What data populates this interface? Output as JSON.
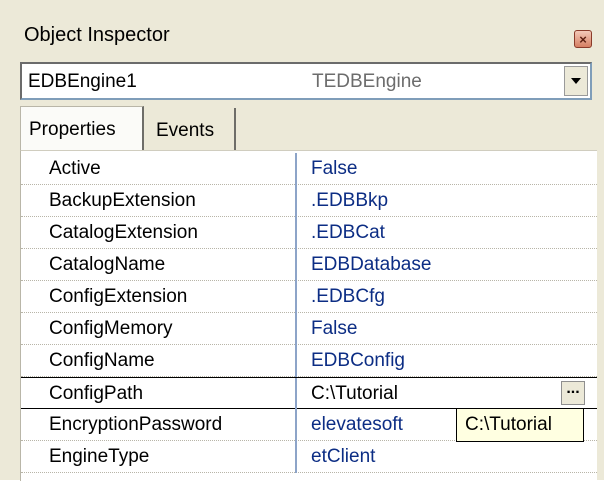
{
  "window": {
    "title": "Object Inspector",
    "close_label": "×"
  },
  "combo": {
    "object_name": "EDBEngine1",
    "object_type": "TEDBEngine"
  },
  "tabs": [
    {
      "label": "Properties"
    },
    {
      "label": "Events"
    }
  ],
  "properties": [
    {
      "name": "Active",
      "value": "False"
    },
    {
      "name": "BackupExtension",
      "value": ".EDBBkp"
    },
    {
      "name": "CatalogExtension",
      "value": ".EDBCat"
    },
    {
      "name": "CatalogName",
      "value": "EDBDatabase"
    },
    {
      "name": "ConfigExtension",
      "value": ".EDBCfg"
    },
    {
      "name": "ConfigMemory",
      "value": "False"
    },
    {
      "name": "ConfigName",
      "value": "EDBConfig"
    },
    {
      "name": "ConfigPath",
      "value": "C:\\Tutorial"
    },
    {
      "name": "EncryptionPassword",
      "value": "elevatesoft"
    },
    {
      "name": "EngineType",
      "value": "etClient"
    }
  ],
  "editor": {
    "ellipsis_label": "...",
    "tooltip": "C:\\Tutorial"
  }
}
